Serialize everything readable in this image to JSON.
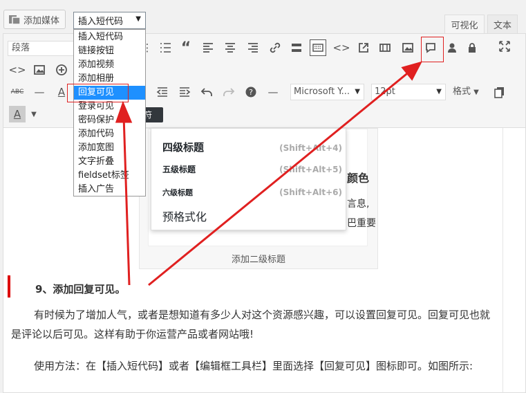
{
  "toolbar_top": {
    "media_button": "添加媒体",
    "shortcode_select": "插入短代码",
    "tabs": [
      "可视化",
      "文本"
    ]
  },
  "editor_toolbar": {
    "format_select": "段落",
    "font_select": "Microsoft Y...",
    "size_select": "12pt",
    "styles_button": "格式",
    "tooltip": "符"
  },
  "shortcode_dropdown": {
    "items": [
      "插入短代码",
      "链接按钮",
      "添加视频",
      "添加相册",
      "回复可见",
      "登录可见",
      "密码保护",
      "添加代码",
      "添加宽图",
      "文字折叠",
      "fieldset标签",
      "插入广告"
    ],
    "selected": "回复可见"
  },
  "figure": {
    "caption": "添加二级标题",
    "fragments": [
      "颜色",
      "言息,",
      "巴重要"
    ],
    "heading_menu": [
      {
        "label": "四级标题",
        "shortcut": "(Shift+Alt+4)"
      },
      {
        "label": "五级标题",
        "shortcut": "(Shift+Alt+5)"
      },
      {
        "label": "六级标题",
        "shortcut": "(Shift+Alt+6)"
      },
      {
        "label": "预格式化",
        "shortcut": ""
      }
    ]
  },
  "content": {
    "section_title": "9、添加回复可见。",
    "paragraph1": "有时候为了增加人气，或者是想知道有多少人对这个资源感兴趣，可以设置回复可见。回复可见也就是评论以后可见。这样有助于你运营产品或者网站哦!",
    "paragraph2": "使用方法：在【插入短代码】或者【编辑框工具栏】里面选择【回复可见】图标即可。如图所示:"
  },
  "colors": {
    "annotation_red": "#e02020",
    "selection_blue": "#1e90ff",
    "section_bar": "#dd0000"
  }
}
